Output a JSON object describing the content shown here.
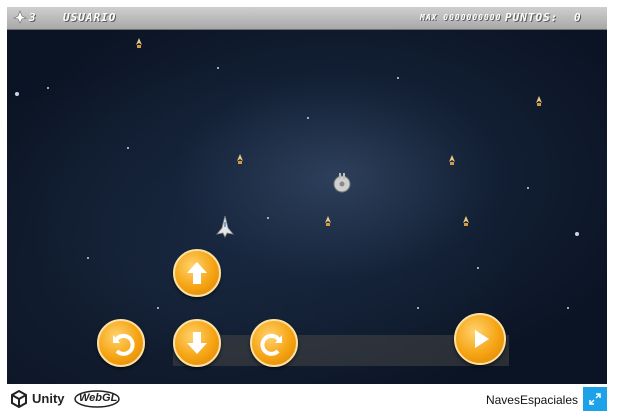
{
  "hud": {
    "lives_count": "3",
    "player_name": "USUARIO",
    "best_label": "MAX 0000000000",
    "score_label": "PUNTOS:",
    "score_value": "0"
  },
  "footer": {
    "unity_label": "Unity",
    "webgl_label": "WebGL",
    "game_title": "NavesEspaciales"
  },
  "controls": [
    "rotate-left",
    "move-up",
    "move-down",
    "rotate-right",
    "fire"
  ],
  "colors": {
    "button_orange": "#f5a312",
    "hud_gray": "#b8b8b8",
    "space": "#0b1424",
    "fullscreen_blue": "#1da1e8"
  }
}
